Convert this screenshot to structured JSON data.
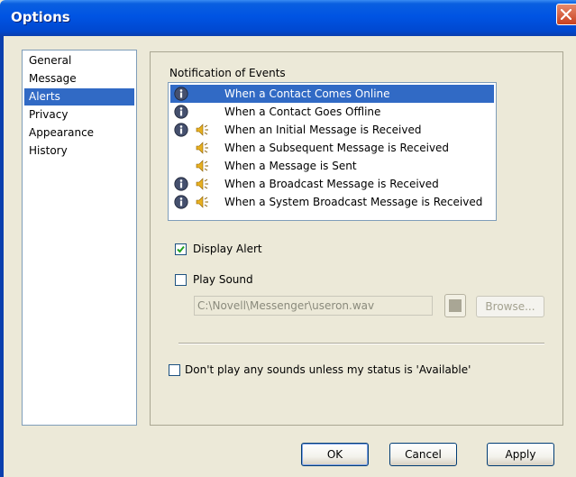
{
  "window": {
    "title": "Options"
  },
  "nav": {
    "items": [
      {
        "label": "General"
      },
      {
        "label": "Message"
      },
      {
        "label": "Alerts",
        "selected": true
      },
      {
        "label": "Privacy"
      },
      {
        "label": "Appearance"
      },
      {
        "label": "History"
      }
    ]
  },
  "alerts": {
    "section_label": "Notification of Events",
    "events": [
      {
        "label": "When a Contact Comes Online",
        "info": true,
        "sound": false,
        "selected": true
      },
      {
        "label": "When a Contact Goes Offline",
        "info": true,
        "sound": false
      },
      {
        "label": "When an Initial Message is Received",
        "info": true,
        "sound": true
      },
      {
        "label": "When a Subsequent Message is Received",
        "info": false,
        "sound": true
      },
      {
        "label": "When a Message is Sent",
        "info": false,
        "sound": true
      },
      {
        "label": "When a Broadcast Message is Received",
        "info": true,
        "sound": true
      },
      {
        "label": "When a System Broadcast Message is Received",
        "info": true,
        "sound": true
      }
    ],
    "display_alert": {
      "label": "Display Alert",
      "checked": true
    },
    "play_sound": {
      "label": "Play Sound",
      "checked": false
    },
    "sound_path": "C:\\Novell\\Messenger\\useron.wav",
    "browse_label": "Browse...",
    "no_sounds": {
      "label": "Don't play any sounds unless my status is 'Available'",
      "checked": false
    }
  },
  "buttons": {
    "ok": "OK",
    "cancel": "Cancel",
    "apply": "Apply"
  },
  "colors": {
    "selection": "#316ac5",
    "titlebar": "#0054e3",
    "dialog": "#ece9d8"
  }
}
